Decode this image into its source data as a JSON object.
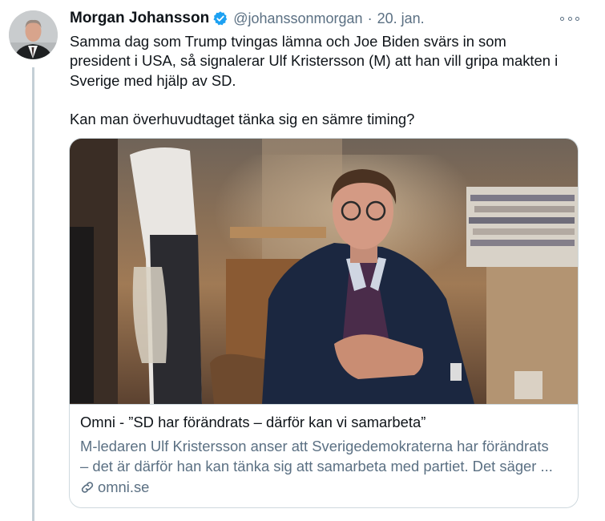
{
  "tweet": {
    "author_name": "Morgan Johansson",
    "handle": "@johanssonmorgan",
    "separator": "·",
    "date": "20. jan.",
    "text_lines": [
      "Samma dag som Trump tvingas lämna och Joe Biden svärs in som",
      "president i USA, så signalerar Ulf Kristersson (M) att han vill gripa makten i",
      "Sverige med hjälp av SD."
    ],
    "text_second": "Kan man överhuvudtaget tänka sig en sämre timing?"
  },
  "card": {
    "title": "Omni - ”SD har förändrats – därför kan vi samarbeta”",
    "description_lines": [
      "M-ledaren Ulf Kristersson anser att Sverigedemokraterna har förändrats",
      "– det är därför han kan tänka sig att samarbeta med partiet. Det säger ..."
    ],
    "domain": "omni.se"
  },
  "colors": {
    "text": "#0f1419",
    "secondary": "#5b7083",
    "verified": "#1da1f2",
    "border": "#cfd9de",
    "thread_line": "#c4cfd6"
  },
  "icons": [
    "verified-badge-icon",
    "more-options-icon",
    "link-icon"
  ]
}
